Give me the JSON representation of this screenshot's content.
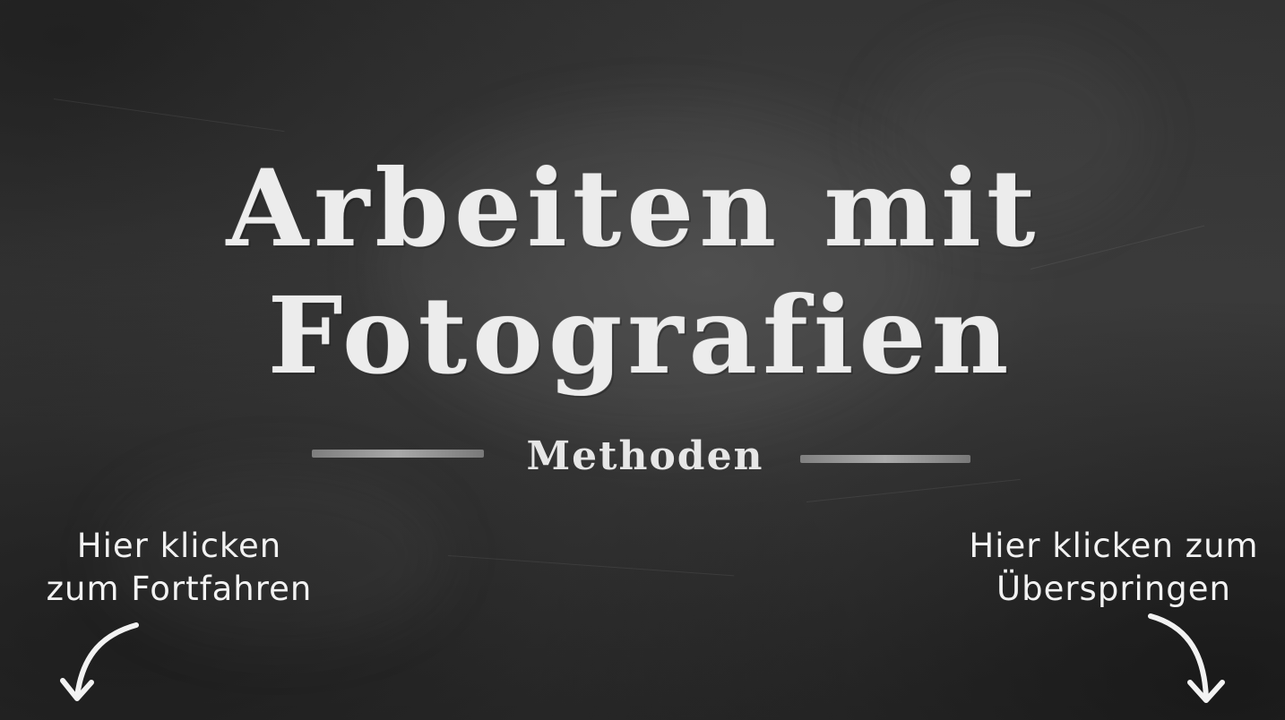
{
  "slide": {
    "title_line1": "Arbeiten mit",
    "title_line2": "Fotografien",
    "subtitle": "Methoden"
  },
  "navigation": {
    "continue": {
      "line1": "Hier klicken",
      "line2": "zum Fortfahren",
      "icon": "curved-arrow-down-left-icon"
    },
    "skip": {
      "line1": "Hier klicken zum",
      "line2": "Überspringen",
      "icon": "curved-arrow-down-right-icon"
    }
  },
  "colors": {
    "board": "#2f2f2f",
    "chalk": "#ececec"
  }
}
